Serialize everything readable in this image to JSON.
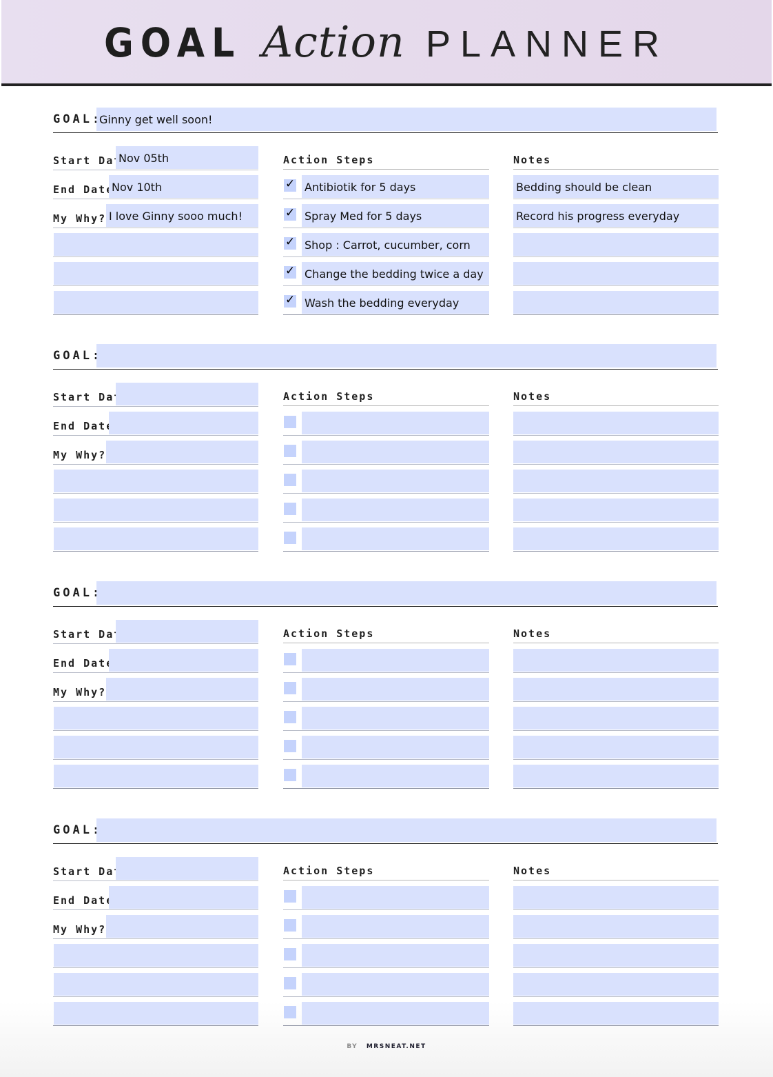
{
  "header": {
    "title_part1": "GOAL",
    "title_part2": "Action",
    "title_part3": "PLANNER",
    "background": "#e6dbec"
  },
  "labels": {
    "goal": "GOAL:",
    "start_date": "Start Date",
    "end_date": "End Date",
    "my_why": "My Why?",
    "action_steps": "Action Steps",
    "notes": "Notes"
  },
  "colors": {
    "field_fill": "#d9e1fd",
    "checkbox_fill": "#c5d3fc"
  },
  "sections": [
    {
      "goal": "Ginny get well soon!",
      "start_date": "Nov 05th",
      "end_date": "Nov 10th",
      "my_why": "I love Ginny sooo much!",
      "extra": [
        "",
        "",
        ""
      ],
      "actions": [
        {
          "text": "Antibiotik for 5 days",
          "checked": true
        },
        {
          "text": "Spray Med for 5 days",
          "checked": true
        },
        {
          "text": "Shop : Carrot, cucumber, corn",
          "checked": true
        },
        {
          "text": "Change the bedding twice a day",
          "checked": true
        },
        {
          "text": "Wash the bedding everyday",
          "checked": true
        }
      ],
      "notes": [
        "Bedding should be clean",
        "Record his progress everyday",
        "",
        "",
        ""
      ]
    },
    {
      "goal": "",
      "start_date": "",
      "end_date": "",
      "my_why": "",
      "extra": [
        "",
        "",
        ""
      ],
      "actions": [
        {
          "text": "",
          "checked": false
        },
        {
          "text": "",
          "checked": false
        },
        {
          "text": "",
          "checked": false
        },
        {
          "text": "",
          "checked": false
        },
        {
          "text": "",
          "checked": false
        }
      ],
      "notes": [
        "",
        "",
        "",
        "",
        ""
      ]
    },
    {
      "goal": "",
      "start_date": "",
      "end_date": "",
      "my_why": "",
      "extra": [
        "",
        "",
        ""
      ],
      "actions": [
        {
          "text": "",
          "checked": false
        },
        {
          "text": "",
          "checked": false
        },
        {
          "text": "",
          "checked": false
        },
        {
          "text": "",
          "checked": false
        },
        {
          "text": "",
          "checked": false
        }
      ],
      "notes": [
        "",
        "",
        "",
        "",
        ""
      ]
    },
    {
      "goal": "",
      "start_date": "",
      "end_date": "",
      "my_why": "",
      "extra": [
        "",
        "",
        ""
      ],
      "actions": [
        {
          "text": "",
          "checked": false
        },
        {
          "text": "",
          "checked": false
        },
        {
          "text": "",
          "checked": false
        },
        {
          "text": "",
          "checked": false
        },
        {
          "text": "",
          "checked": false
        }
      ],
      "notes": [
        "",
        "",
        "",
        "",
        ""
      ]
    }
  ],
  "footer": {
    "by": "BY",
    "site": "MRSNEAT.NET"
  }
}
